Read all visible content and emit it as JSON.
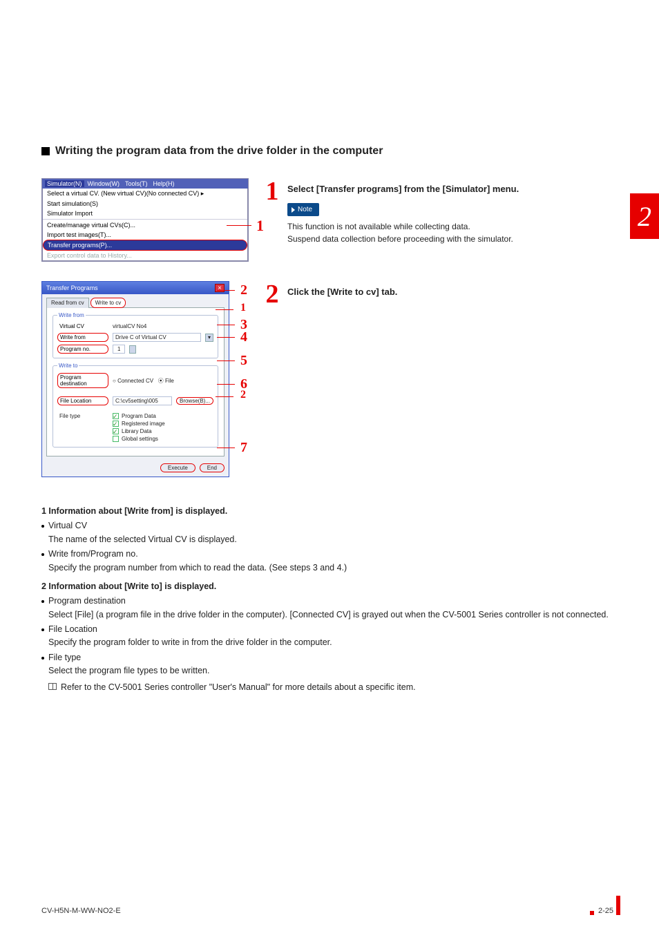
{
  "heading": "Writing the program data from the drive folder in the computer",
  "chapter": "2",
  "menu": {
    "bar": [
      "Simulator(N)",
      "Window(W)",
      "Tools(T)",
      "Help(H)"
    ],
    "items": [
      "Select a virtual CV. (New virtual CV)(No connected CV)  ▸",
      "Start simulation(S)",
      "Simulator Import",
      "Create/manage virtual CVs(C)...",
      "Import test images(T)...",
      "Transfer programs(P)...",
      "Export control data to History..."
    ]
  },
  "steps": [
    {
      "title": "Select [Transfer programs] from the [Simulator] menu.",
      "note_label": "Note",
      "note": [
        "This function is not available while collecting data.",
        "Suspend data collection before proceeding with the simulator."
      ]
    },
    {
      "title": "Click the [Write to cv] tab."
    }
  ],
  "dialog": {
    "title": "Transfer Programs",
    "tabs": [
      "Read from cv",
      "Write to cv"
    ],
    "write_from": {
      "legend": "Write from",
      "rows": [
        {
          "label": "Virtual CV",
          "value": "virtualCV No4"
        },
        {
          "label": "Write from",
          "value": "Drive C of Virtual CV"
        },
        {
          "label": "Program no.",
          "value": "1"
        }
      ]
    },
    "write_to": {
      "legend": "Write to",
      "rows": [
        {
          "label": "Program destination",
          "options": [
            "Connected CV",
            "File"
          ]
        },
        {
          "label": "File Location",
          "value": "C:\\cv5setting\\005",
          "browse": "Browse(B)..."
        },
        {
          "label": "File type",
          "options": [
            "Program Data",
            "Registered image",
            "Library Data",
            "Global settings"
          ]
        }
      ]
    },
    "buttons": [
      "Execute",
      "End"
    ]
  },
  "info": [
    {
      "head": "1    Information about [Write from] is displayed.",
      "items": [
        {
          "label": "Virtual CV",
          "desc": "The name of the selected Virtual CV is displayed."
        },
        {
          "label": "Write from/Program no.",
          "desc": "Specify the program number from which to read the data. (See steps 3 and 4.)"
        }
      ]
    },
    {
      "head": "2    Information about [Write to] is displayed.",
      "items": [
        {
          "label": "Program destination",
          "desc": "Select [File] (a program file in the drive folder in the computer). [Connected CV] is grayed out when the CV-5001 Series controller is not connected."
        },
        {
          "label": "File Location",
          "desc": "Specify the program folder to write in from the drive folder in the computer."
        },
        {
          "label": "File type",
          "desc": "Select the program file types to be written.",
          "ref": "Refer to the CV-5001 Series controller \"User's Manual\" for more details about a specific item."
        }
      ]
    }
  ],
  "footer": {
    "code": "CV-H5N-M-WW-NO2-E",
    "page": "2-25"
  }
}
